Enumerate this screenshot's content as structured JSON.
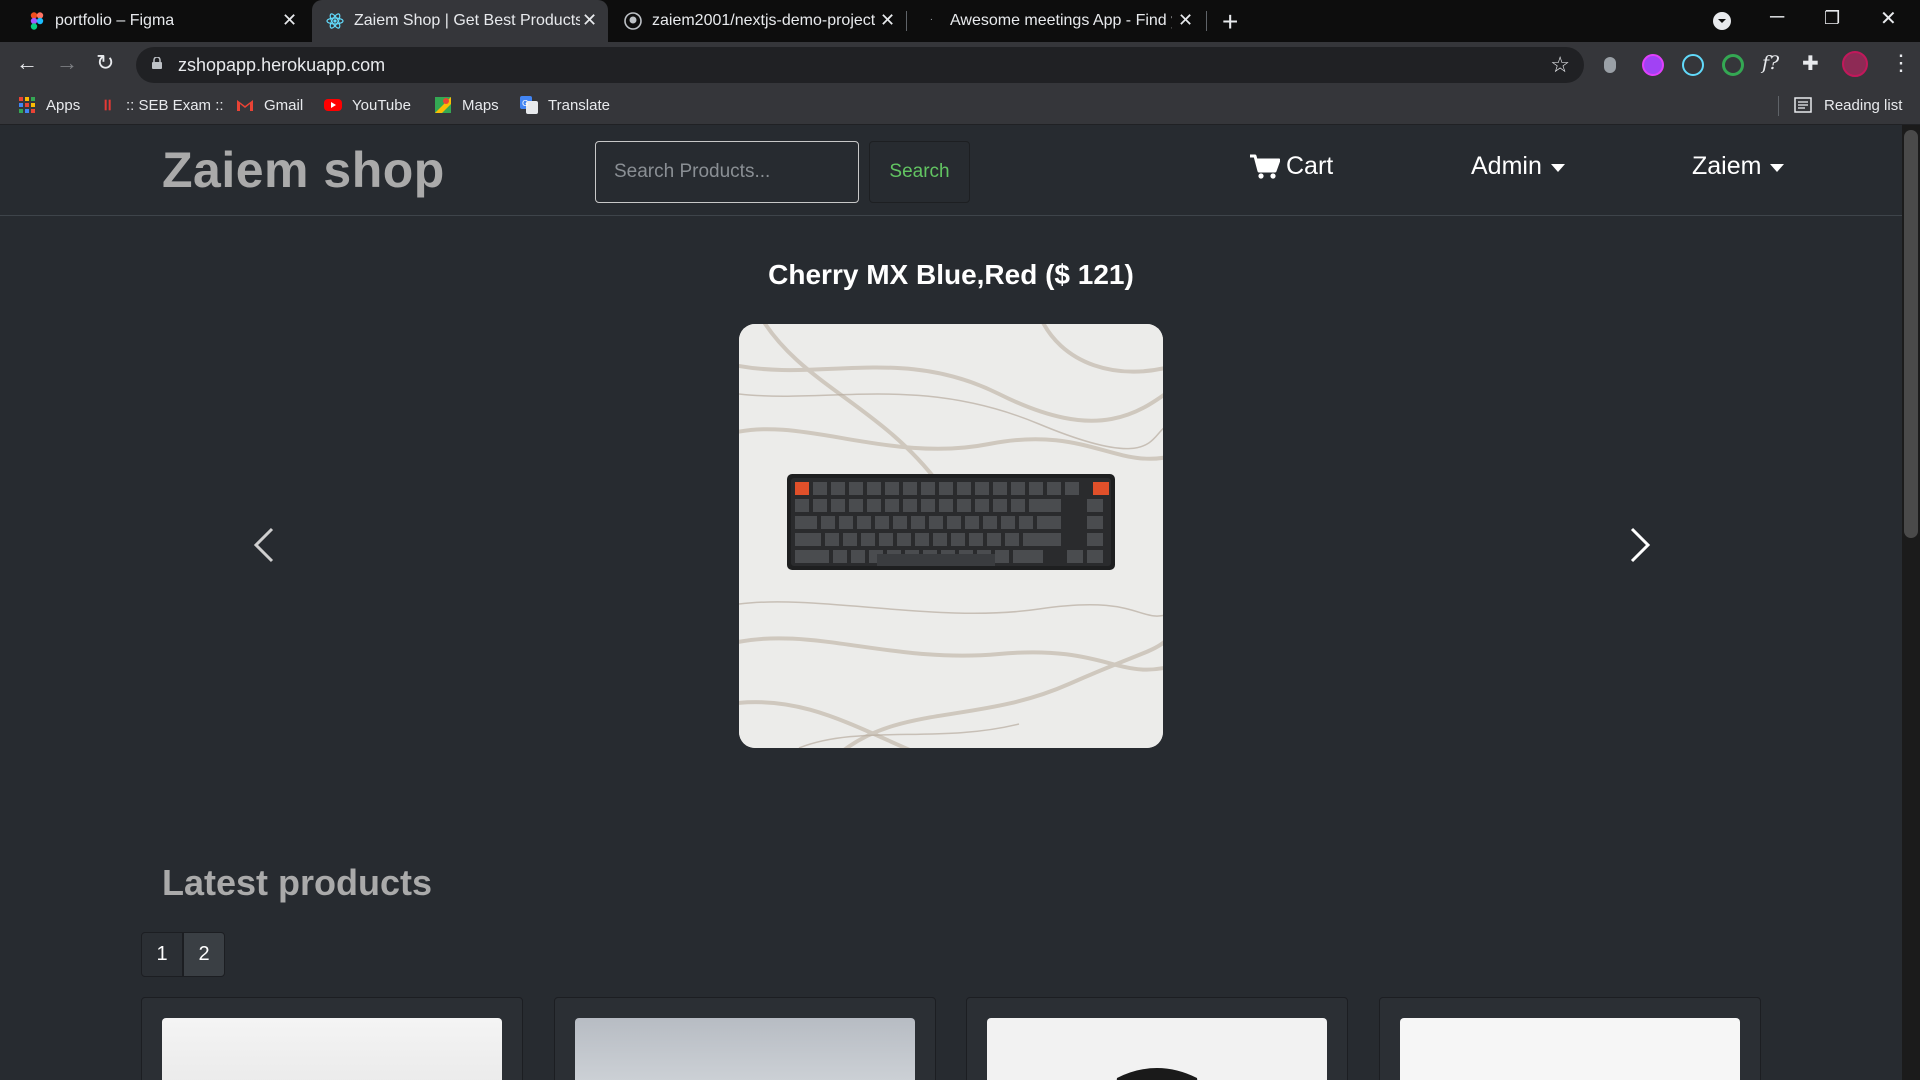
{
  "browser": {
    "tabs": [
      {
        "title": "portfolio – Figma",
        "active": false
      },
      {
        "title": "Zaiem Shop | Get Best Products a",
        "active": true
      },
      {
        "title": "zaiem2001/nextjs-demo-project",
        "active": false
      },
      {
        "title": "Awesome meetings App - Find y",
        "active": false
      }
    ],
    "url": "zshopapp.herokuapp.com",
    "bookmarks": [
      {
        "label": "Apps",
        "icon": "apps-grid-icon"
      },
      {
        "label": ":: SEB Exam ::",
        "icon": "seb-exam-icon"
      },
      {
        "label": "Gmail",
        "icon": "gmail-icon"
      },
      {
        "label": "YouTube",
        "icon": "youtube-icon"
      },
      {
        "label": "Maps",
        "icon": "maps-icon"
      },
      {
        "label": "Translate",
        "icon": "translate-icon"
      }
    ],
    "reading_list": "Reading list"
  },
  "navbar": {
    "brand": "Zaiem shop",
    "search_placeholder": "Search Products...",
    "search_button": "Search",
    "cart": "Cart",
    "admin": "Admin",
    "user": "Zaiem"
  },
  "carousel": {
    "title": "Cherry MX Blue,Red ($ 121)"
  },
  "latest": {
    "title": "Latest products",
    "pages": [
      "1",
      "2"
    ],
    "active_page": "2"
  },
  "colors": {
    "page_bg": "#272b30",
    "success": "#62c462",
    "muted_heading": "#aaaaaa"
  }
}
